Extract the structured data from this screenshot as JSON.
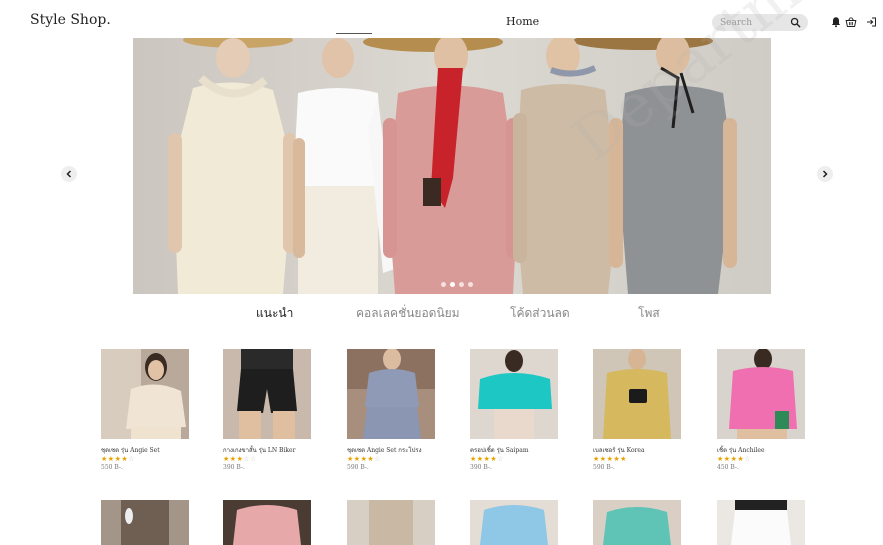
{
  "header": {
    "brand": "Style Shop.",
    "nav_home": "Home",
    "search_placeholder": "Search"
  },
  "tabs": [
    {
      "label": "แนะนำ",
      "active": true
    },
    {
      "label": "คอลเลคชั่นยอดนิยม",
      "active": false
    },
    {
      "label": "โค้ดส่วนลด",
      "active": false
    },
    {
      "label": "โพส",
      "active": false
    }
  ],
  "carousel": {
    "slides": 4,
    "active_slide": 2
  },
  "products": [
    {
      "name": "ชุดเซต รุ่น Angie Set",
      "rating": 4,
      "price": "550 B-."
    },
    {
      "name": "กางเกงขาสั้น รุ่น LN Biker",
      "rating": 3,
      "price": "390 B-."
    },
    {
      "name": "ชุดเซต Angie Set กระโปรง",
      "rating": 4,
      "price": "590 B-."
    },
    {
      "name": "ครอปเชิ้ต รุ่น Saipam",
      "rating": 4,
      "price": "390 B-."
    },
    {
      "name": "เบลเซอร์ รุ่น Korea",
      "rating": 5,
      "price": "590 B-."
    },
    {
      "name": "เชิ้ต รุ่น Anchilee",
      "rating": 4,
      "price": "450 B-."
    }
  ],
  "watermark": "Department",
  "colors": {
    "star": "#e8a200",
    "search_bg": "#e6e6e6"
  }
}
